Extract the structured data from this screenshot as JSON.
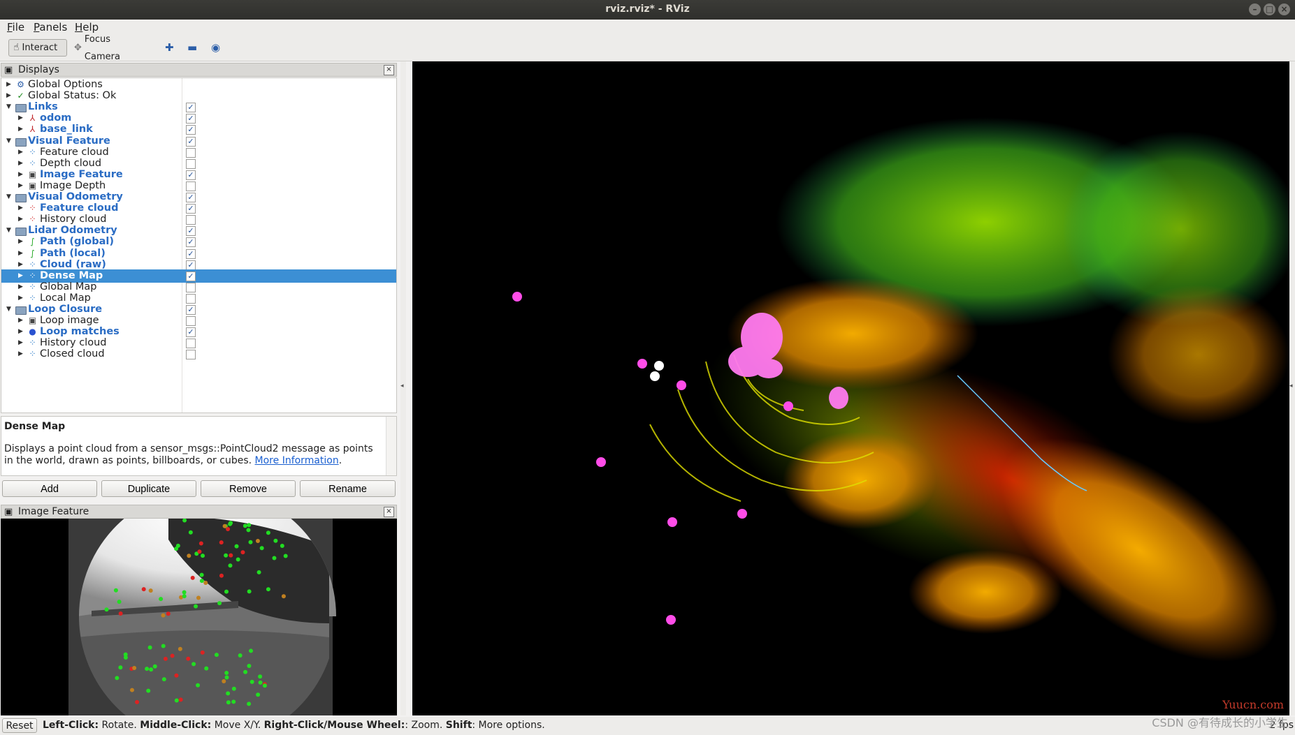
{
  "window": {
    "title": "rviz.rviz* - RViz"
  },
  "menu": {
    "file": "File",
    "panels": "Panels",
    "help": "Help"
  },
  "toolbar": {
    "interact": "Interact",
    "focus_camera": "Focus Camera"
  },
  "displays_panel": {
    "title": "Displays",
    "rows": [
      {
        "label": "Global Options",
        "icon": "gear-icon",
        "level": 0,
        "bold": false,
        "checked": null
      },
      {
        "label": "Global Status: Ok",
        "icon": "checkmark-icon",
        "level": 0,
        "bold": false,
        "checked": null
      },
      {
        "label": "Links",
        "icon": "folder-icon",
        "level": 0,
        "bold": true,
        "checked": true,
        "expanded": true
      },
      {
        "label": "odom",
        "icon": "axes-icon",
        "level": 1,
        "bold": true,
        "checked": true
      },
      {
        "label": "base_link",
        "icon": "axes-icon",
        "level": 1,
        "bold": true,
        "checked": true
      },
      {
        "label": "Visual Feature",
        "icon": "folder-icon",
        "level": 0,
        "bold": true,
        "checked": true,
        "expanded": true
      },
      {
        "label": "Feature cloud",
        "icon": "pointcloud-icon",
        "level": 1,
        "bold": false,
        "checked": false
      },
      {
        "label": "Depth cloud",
        "icon": "pointcloud-icon",
        "level": 1,
        "bold": false,
        "checked": false
      },
      {
        "label": "Image Feature",
        "icon": "image-icon",
        "level": 1,
        "bold": true,
        "checked": true
      },
      {
        "label": "Image Depth",
        "icon": "image-icon",
        "level": 1,
        "bold": false,
        "checked": false
      },
      {
        "label": "Visual Odometry",
        "icon": "folder-icon",
        "level": 0,
        "bold": true,
        "checked": true,
        "expanded": true
      },
      {
        "label": "Feature cloud",
        "icon": "pointcloud-red-icon",
        "level": 1,
        "bold": true,
        "checked": true
      },
      {
        "label": "History cloud",
        "icon": "pointcloud-red-icon",
        "level": 1,
        "bold": false,
        "checked": false
      },
      {
        "label": "Lidar Odometry",
        "icon": "folder-icon",
        "level": 0,
        "bold": true,
        "checked": true,
        "expanded": true
      },
      {
        "label": "Path (global)",
        "icon": "path-icon",
        "level": 1,
        "bold": true,
        "checked": true
      },
      {
        "label": "Path (local)",
        "icon": "path-icon",
        "level": 1,
        "bold": true,
        "checked": true
      },
      {
        "label": "Cloud (raw)",
        "icon": "pointcloud-icon",
        "level": 1,
        "bold": true,
        "checked": true
      },
      {
        "label": "Dense Map",
        "icon": "pointcloud-icon",
        "level": 1,
        "bold": true,
        "checked": true,
        "selected": true
      },
      {
        "label": "Global Map",
        "icon": "pointcloud-icon",
        "level": 1,
        "bold": false,
        "checked": false
      },
      {
        "label": "Local Map",
        "icon": "pointcloud-icon",
        "level": 1,
        "bold": false,
        "checked": false
      },
      {
        "label": "Loop Closure",
        "icon": "folder-icon",
        "level": 0,
        "bold": true,
        "checked": true,
        "expanded": true
      },
      {
        "label": "Loop image",
        "icon": "image-icon",
        "level": 1,
        "bold": false,
        "checked": false
      },
      {
        "label": "Loop matches",
        "icon": "markers-icon",
        "level": 1,
        "bold": true,
        "checked": true
      },
      {
        "label": "History cloud",
        "icon": "pointcloud-icon",
        "level": 1,
        "bold": false,
        "checked": false
      },
      {
        "label": "Closed cloud",
        "icon": "pointcloud-icon",
        "level": 1,
        "bold": false,
        "checked": false
      }
    ]
  },
  "description": {
    "heading": "Dense Map",
    "body": "Displays a point cloud from a sensor_msgs::PointCloud2 message as points in the world, drawn as points, billboards, or cubes.",
    "link": "More Information",
    "period": "."
  },
  "buttons": {
    "add": "Add",
    "duplicate": "Duplicate",
    "remove": "Remove",
    "rename": "Rename"
  },
  "image_panel": {
    "title": "Image Feature"
  },
  "status": {
    "reset": "Reset",
    "hint_parts": [
      {
        "b": "Left-Click:",
        "t": " Rotate. "
      },
      {
        "b": "Middle-Click:",
        "t": " Move X/Y. "
      },
      {
        "b": "Right-Click/Mouse Wheel:",
        "t": ": Zoom. "
      },
      {
        "b": "Shift",
        "t": ": More options."
      }
    ],
    "fps": "2 fps"
  },
  "watermark": {
    "site": "Yuucn.com",
    "csdn": "CSDN @有待成长的小学生"
  },
  "colors": {
    "selection": "#3c8fd4",
    "bold_label": "#2a6cc4",
    "marker": "#ff4de8"
  }
}
